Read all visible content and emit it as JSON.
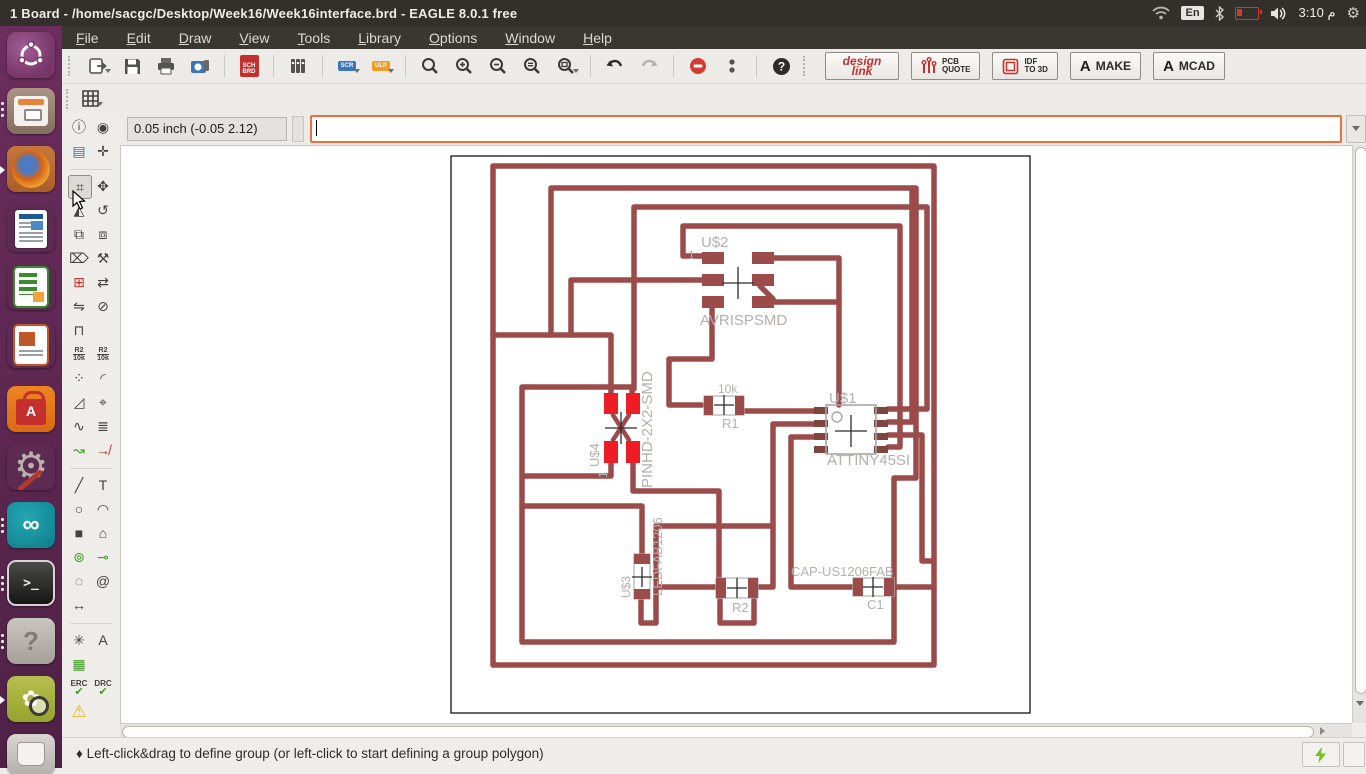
{
  "titlebar": {
    "title": "1 Board - /home/sacgc/Desktop/Week16/Week16interface.brd - EAGLE 8.0.1 free",
    "keyboard_indicator": "En",
    "time_prefix": "م",
    "time": "3:10"
  },
  "menubar": {
    "items": [
      "File",
      "Edit",
      "Draw",
      "View",
      "Tools",
      "Library",
      "Options",
      "Window",
      "Help"
    ]
  },
  "toolbar": {
    "sch": "SCH",
    "brd": "BRD",
    "scr": "SCR",
    "ulp": "ULP",
    "design_line1": "design",
    "design_line2": "link",
    "pcb_lines": "PCB\nQUOTE",
    "idf_lines": "IDF\nTO 3D",
    "autodesk_glyph": "A",
    "make": "MAKE",
    "mcad": "MCAD",
    "help_glyph": "?"
  },
  "coordbar": {
    "coordinates": "0.05 inch (-0.05 2.12)"
  },
  "command_input": {
    "value": "",
    "placeholder": ""
  },
  "launcher": {
    "items": [
      "ubuntu-dash",
      "files",
      "firefox",
      "libreoffice-writer",
      "libreoffice-calc",
      "libreoffice-impress",
      "ubuntu-software",
      "system-settings",
      "arduino",
      "terminal",
      "help",
      "screenshot-tool",
      "trash"
    ],
    "terminal_glyph": ">_",
    "help_glyph": "?",
    "software_glyph": "A",
    "arduino_glyph": "∞"
  },
  "palette": {
    "glyphs": {
      "info": "ⓘ",
      "show": "◉",
      "layers": "▤",
      "mark": "✛",
      "group": "⌗",
      "move": "✥",
      "mirror": "◭",
      "rotate": "↺",
      "copy": "⧉",
      "paste": "⧈",
      "delete": "⌦",
      "change": "⚒",
      "add": "⊞",
      "replace": "⇄",
      "pinswap": "⇋",
      "lock": "⊘",
      "padlock": "⊓",
      "smash": "⁘",
      "miter": "◜",
      "split": "◿",
      "optimize": "⌖",
      "meander": "∿",
      "ratsnest": "≣",
      "route": "↝",
      "ripup": "↛",
      "wire": "╱",
      "text": "T",
      "circle": "○",
      "arc": "◠",
      "rect": "■",
      "polygon": "⌂",
      "via": "⊚",
      "signal": "⊸",
      "hole": "◌",
      "attribute": "@",
      "dimension": "↔",
      "autoroute": "✳",
      "label": "A",
      "array": "▦",
      "errors": "⚠"
    },
    "name_ref": "R2",
    "name_val": "10k",
    "value_ref": "R2",
    "value_val": "10k",
    "erc": "ERC",
    "drc": "DRC",
    "check": "✔"
  },
  "board": {
    "u2_ref": "U$2",
    "u2_pin": "1",
    "u2_val": "AVRISPSMD",
    "r1_val": "10k",
    "r1_ref": "R1",
    "u1_ref": "U$1",
    "u1_val": "ATTINY45SI",
    "u4_ref": "U$4",
    "u4_pin": "1",
    "u4_val": "PINHD-2X2-SMD",
    "u3_ref": "U$3",
    "u3_val": "LEDFAB1206",
    "r2_ref": "R2",
    "c1_val": "CAP-US1206FAB",
    "c1_ref": "C1"
  },
  "statusbar": {
    "message": "♦ Left-click&drag to define group (or left-click to start defining a group polygon)"
  }
}
